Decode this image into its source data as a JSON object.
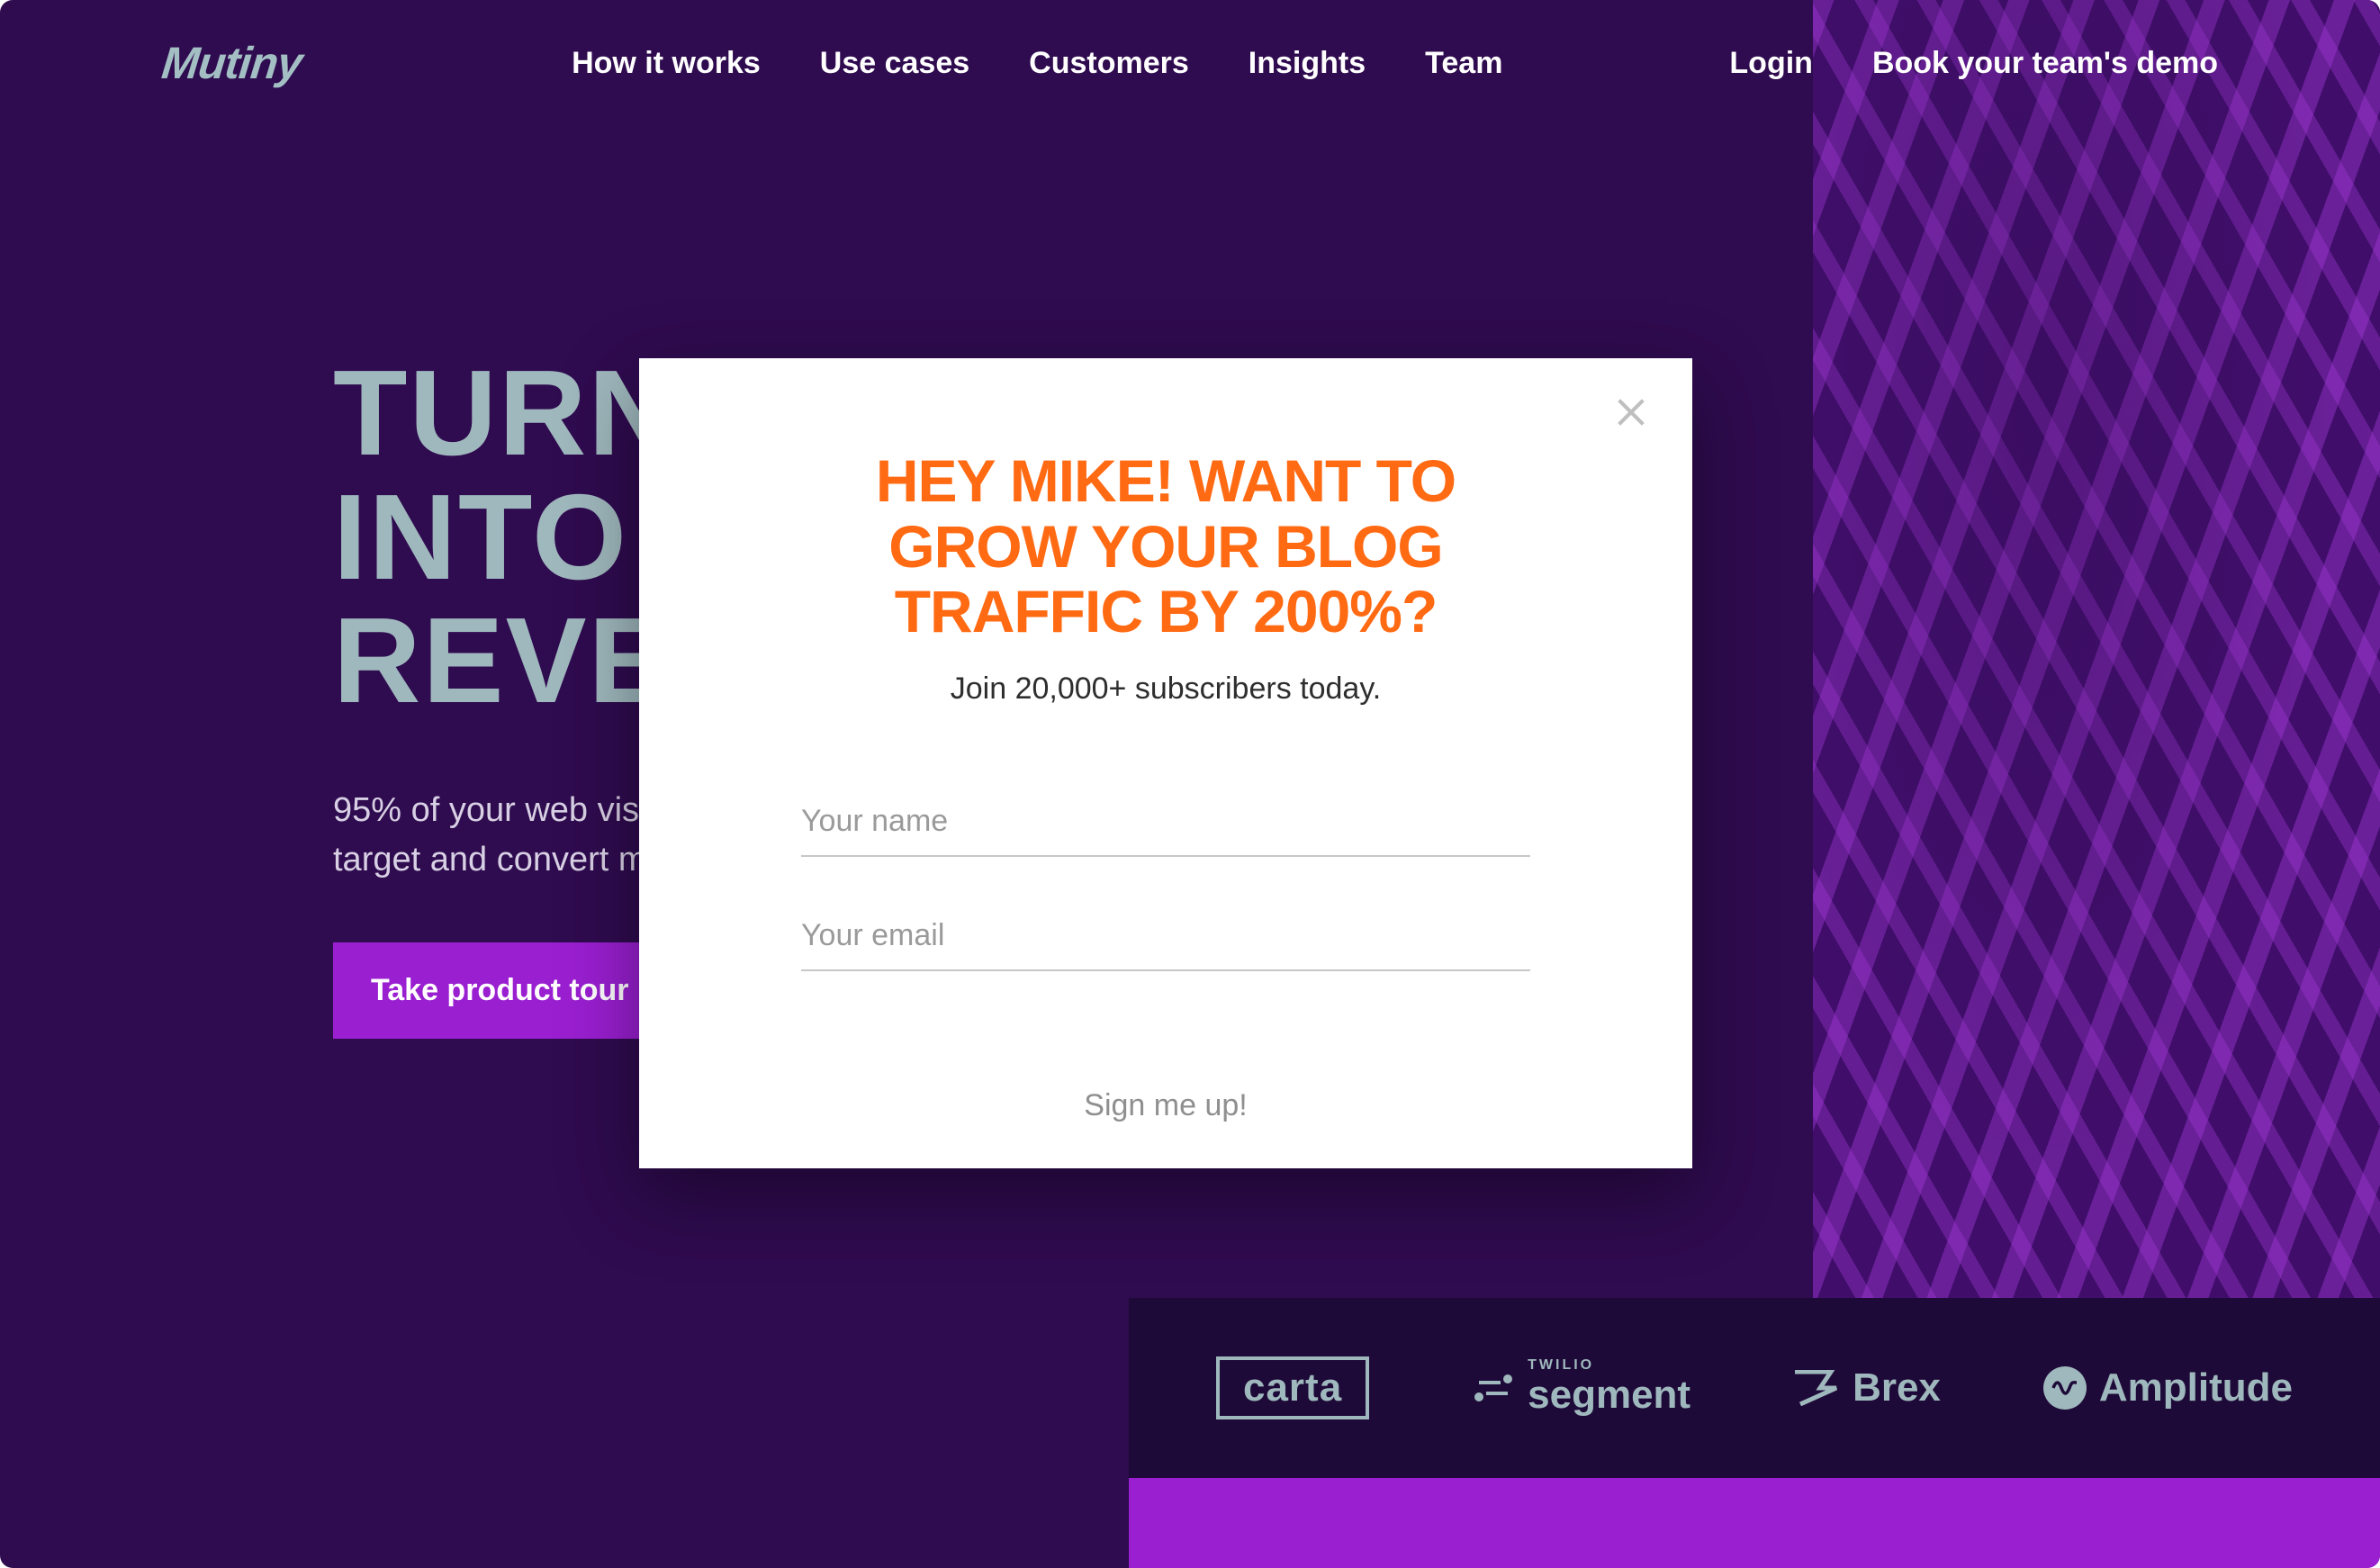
{
  "header": {
    "logo": "Mutiny",
    "nav": [
      "How it works",
      "Use cases",
      "Customers",
      "Insights",
      "Team"
    ],
    "login": "Login",
    "demo": "Book your team's demo"
  },
  "hero": {
    "title_line1": "TURN",
    "title_line2": "INTO",
    "title_line3": "REVE",
    "subtitle_line1": "95% of your web visit",
    "subtitle_line2": "target and convert m",
    "cta": "Take product tour"
  },
  "clients": {
    "carta": "carta",
    "segment_small": "TWILIO",
    "segment": "segment",
    "brex": "Brex",
    "amplitude": "Amplitude"
  },
  "modal": {
    "title": "HEY MIKE! WANT TO GROW YOUR BLOG TRAFFIC BY 200%?",
    "subtitle": "Join 20,000+ subscribers today.",
    "name_placeholder": "Your name",
    "email_placeholder": "Your email",
    "submit": "Sign me up!"
  }
}
